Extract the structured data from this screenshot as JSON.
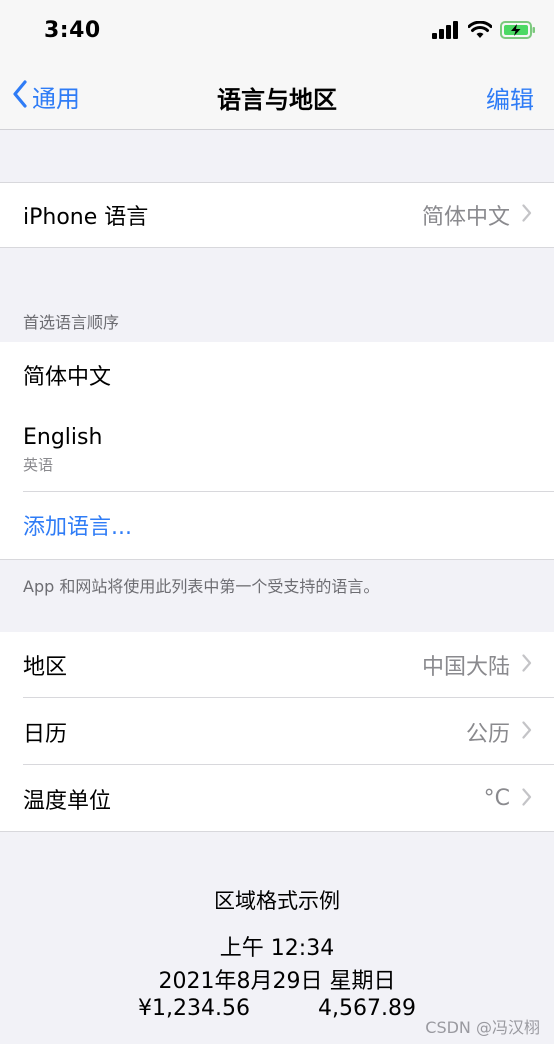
{
  "status": {
    "time": "3:40"
  },
  "nav": {
    "back_label": "通用",
    "title": "语言与地区",
    "edit_label": "编辑"
  },
  "iphone_language": {
    "label": "iPhone 语言",
    "value": "简体中文"
  },
  "preferred": {
    "header": "首选语言顺序",
    "items": [
      {
        "name": "简体中文",
        "sub": ""
      },
      {
        "name": "English",
        "sub": "英语"
      }
    ],
    "add_label": "添加语言...",
    "footer": "App 和网站将使用此列表中第一个受支持的语言。"
  },
  "region_settings": [
    {
      "label": "地区",
      "value": "中国大陆"
    },
    {
      "label": "日历",
      "value": "公历"
    },
    {
      "label": "温度单位",
      "value": "°C"
    }
  ],
  "format_example": {
    "title": "区域格式示例",
    "time": "上午 12:34",
    "date": "2021年8月29日 星期日",
    "currency": "¥1,234.56",
    "number": "4,567.89"
  },
  "watermark": "CSDN @冯汉栩",
  "colors": {
    "accent": "#2f7cf6",
    "battery": "#4cd964"
  },
  "icons": {
    "signal": "cellular-signal-icon",
    "wifi": "wifi-icon",
    "battery": "battery-charging-icon",
    "back": "chevron-left-icon",
    "disclosure": "chevron-right-icon"
  }
}
